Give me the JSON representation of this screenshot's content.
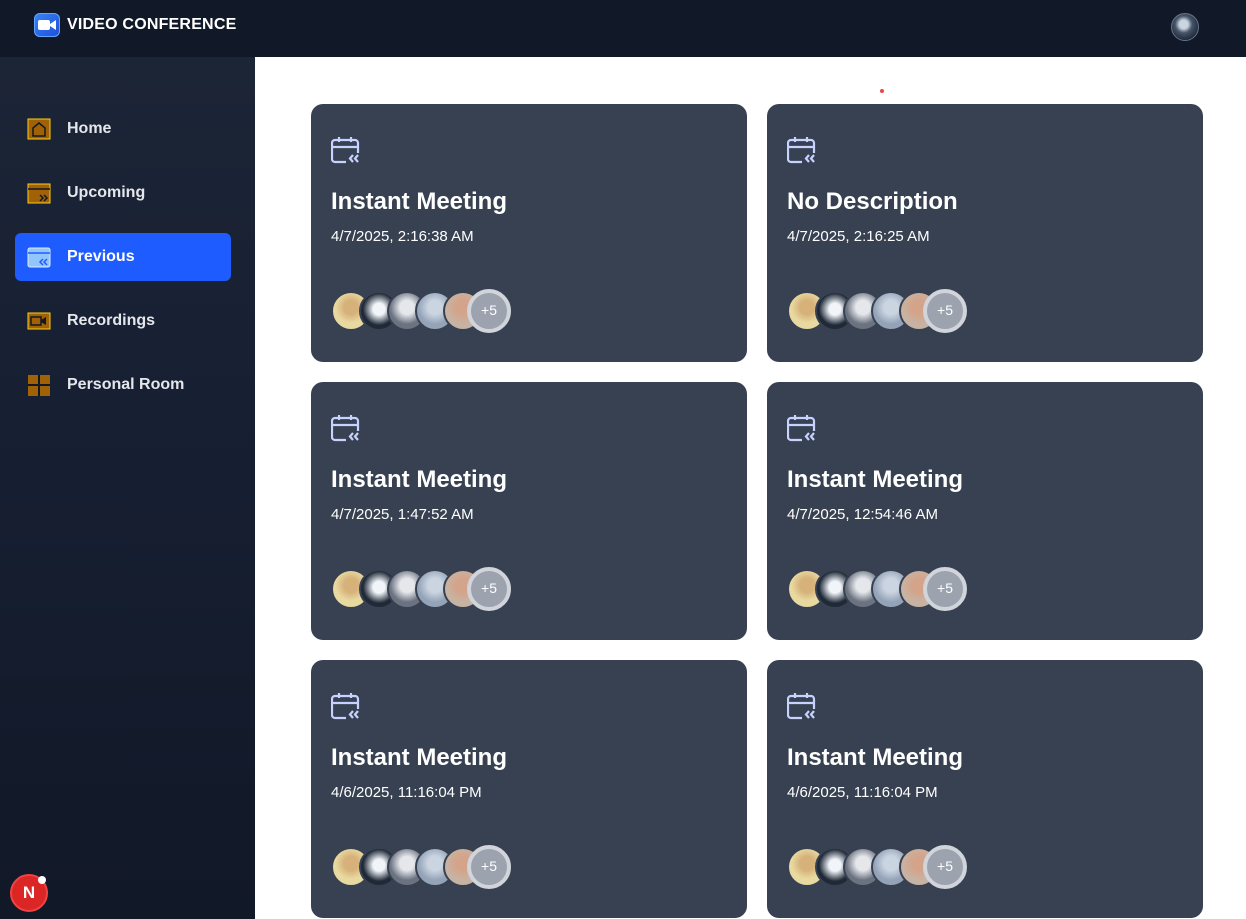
{
  "app": {
    "brand": "VIDEO CONFERENCE"
  },
  "sidebar": {
    "items": [
      {
        "label": "Home",
        "icon": "home-icon"
      },
      {
        "label": "Upcoming",
        "icon": "calendar-forward-icon"
      },
      {
        "label": "Previous",
        "icon": "calendar-back-icon",
        "active": true
      },
      {
        "label": "Recordings",
        "icon": "video-icon"
      },
      {
        "label": "Personal Room",
        "icon": "grid-icon"
      }
    ]
  },
  "user_badge": "N",
  "meetings": [
    {
      "title": "Instant Meeting",
      "date": "4/7/2025, 2:16:38 AM",
      "more": "+5"
    },
    {
      "title": "No Description",
      "date": "4/7/2025, 2:16:25 AM",
      "more": "+5"
    },
    {
      "title": "Instant Meeting",
      "date": "4/7/2025, 1:47:52 AM",
      "more": "+5"
    },
    {
      "title": "Instant Meeting",
      "date": "4/7/2025, 12:54:46 AM",
      "more": "+5"
    },
    {
      "title": "Instant Meeting",
      "date": "4/6/2025, 11:16:04 PM",
      "more": "+5"
    },
    {
      "title": "Instant Meeting",
      "date": "4/6/2025, 11:16:04 PM",
      "more": "+5"
    }
  ],
  "colors": {
    "topbar": "#111827",
    "sidebar": "#1c2536",
    "active": "#1f5cff",
    "card": "#374151"
  }
}
